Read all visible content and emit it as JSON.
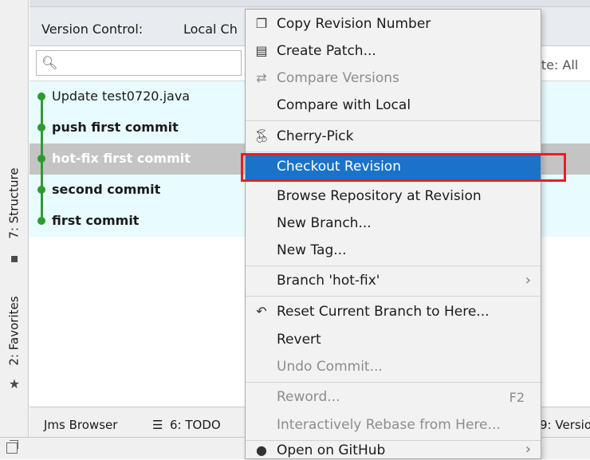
{
  "left_strip": {
    "structure_label": "7: Structure",
    "favorites_label": "2: Favorites"
  },
  "header": {
    "title": "Version Control:",
    "tab_label": "Local Ch"
  },
  "search": {
    "placeholder": "",
    "date_filter": "ate: All"
  },
  "commits": [
    {
      "label": "Update test0720.java",
      "bold": false,
      "selected": false
    },
    {
      "label": "push first commit",
      "bold": true,
      "selected": false
    },
    {
      "label": "hot-fix first commit",
      "bold": true,
      "selected": true
    },
    {
      "label": "second commit",
      "bold": true,
      "selected": false
    },
    {
      "label": "first commit",
      "bold": true,
      "selected": false
    }
  ],
  "bottom_tabs": {
    "jms": "Jms Browser",
    "todo": "6: TODO",
    "version": "9: Versio"
  },
  "menu": {
    "items": [
      {
        "label": "Copy Revision Number",
        "icon": "copy-icon"
      },
      {
        "label": "Create Patch...",
        "icon": "patch-icon"
      },
      {
        "label": "Compare Versions",
        "icon": "compare-icon",
        "disabled": true
      },
      {
        "label": "Compare with Local"
      },
      {
        "label": "Cherry-Pick",
        "icon": "cherry-icon"
      },
      {
        "label": "Checkout Revision",
        "highlighted": true
      },
      {
        "label": "Browse Repository at Revision"
      },
      {
        "label": "New Branch..."
      },
      {
        "label": "New Tag..."
      },
      {
        "label": "Branch 'hot-fix'",
        "submenu": true
      },
      {
        "label": "Reset Current Branch to Here...",
        "icon": "undo-icon"
      },
      {
        "label": "Revert"
      },
      {
        "label": "Undo Commit...",
        "disabled": true
      },
      {
        "label": "Reword...",
        "disabled": true,
        "shortcut": "F2"
      },
      {
        "label": "Interactively Rebase from Here...",
        "disabled": true
      },
      {
        "label": "Open on GitHub",
        "icon": "github-icon",
        "submenu": true
      }
    ]
  },
  "colors": {
    "highlight": "#1a73c8",
    "callout": "#e0202a",
    "commit_dot": "#2d9c2d",
    "row_bg": "#e8fbff"
  }
}
